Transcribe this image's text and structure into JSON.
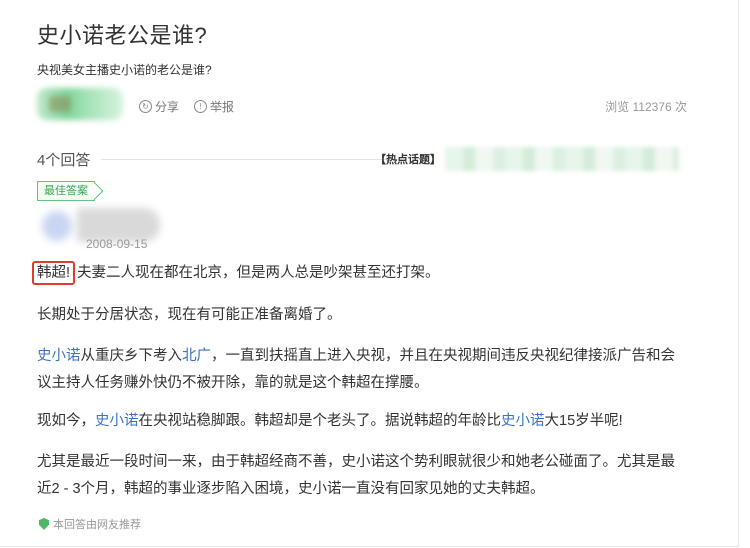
{
  "question": {
    "title": "史小诺老公是谁?",
    "subtitle": "央视美女主播史小诺的老公是谁?",
    "share_label": "分享",
    "report_label": "举报",
    "views": "浏览 112376 次"
  },
  "answers": {
    "count_label": "4个回答",
    "hot_topics_label": "【热点话题】"
  },
  "best_answer": {
    "badge": "最佳答案",
    "date": "2008-09-15",
    "p1_highlight": "韩超!",
    "p1_rest": "夫妻二人现在都在北京，但是两人总是吵架甚至还打架。",
    "p2": "长期处于分居状态，现在有可能正准备离婚了。",
    "p3_link1": "史小诺",
    "p3_mid": "从重庆乡下考入",
    "p3_link2": "北广",
    "p3_rest_line1": "，一直到扶摇直上进入央视，并且在央视期间违反央视纪律接派广告和会",
    "p3_line2": "议主持人任务赚外快仍不被开除，靠的就是这个韩超在撑腰。",
    "p4_pre": "现如今，",
    "p4_link1": "史小诺",
    "p4_mid": "在央视站稳脚跟。韩超却是个老头了。据说韩超的年龄比",
    "p4_link2": "史小诺",
    "p4_end": "大15岁半呢!",
    "p5_line1": "尤其是最近一段时间一来，由于韩超经商不善，史小诺这个势利眼就很少和她老公碰面了。尤其是最",
    "p5_line2": "近2 - 3个月，韩超的事业逐步陷入困境，史小诺一直没有回家见她的丈夫韩超。",
    "footer": "本回答由网友推荐"
  }
}
